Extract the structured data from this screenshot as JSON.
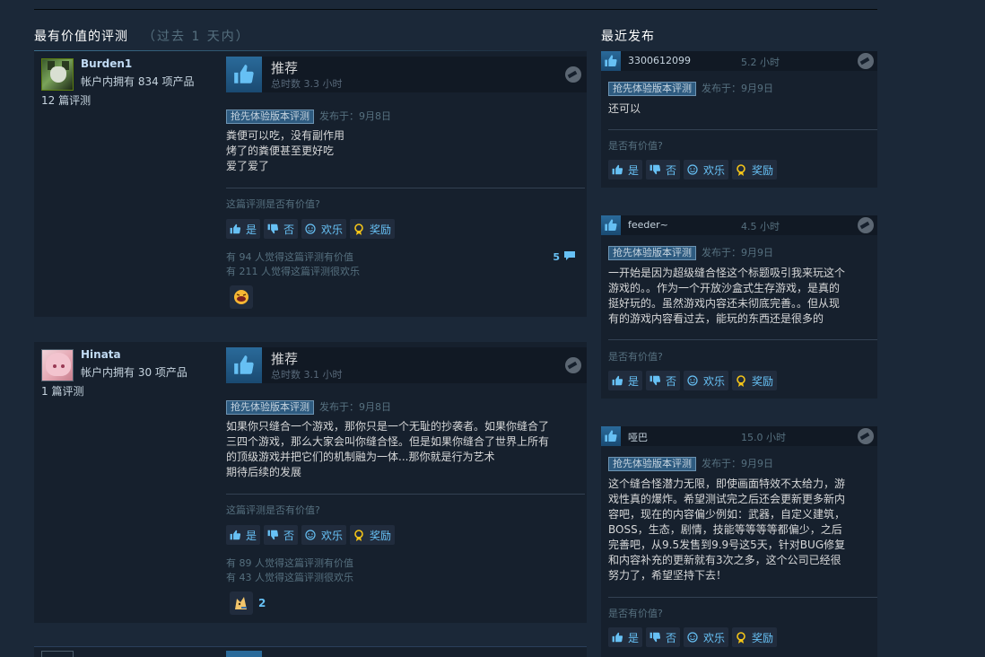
{
  "most_helpful": {
    "title": "最有价值的评测",
    "subtitle": "（过去 1 天内）"
  },
  "recent": {
    "title": "最近发布"
  },
  "buttons": {
    "yes": "是",
    "no": "否",
    "funny": "欢乐",
    "award": "奖励"
  },
  "helpful_question_long": "这篇评测是否有价值?",
  "helpful_question_short": "是否有价值?",
  "ea_tag": "抢先体验版本评测",
  "reviews": [
    {
      "author": "Burden1",
      "products_owned": "帐户内拥有 834 项产品",
      "review_count": "12 篇评测",
      "verdict": "推荐",
      "hours": "总时数 3.3 小时",
      "posted": "发布于：9月8日",
      "text": [
        "粪便可以吃，没有副作用",
        "烤了的粪便甚至更好吃",
        "爱了爱了"
      ],
      "helpful": "有 94 人觉得这篇评测有价值",
      "funny": "有 211 人觉得这篇评测很欢乐",
      "comments": "5",
      "award_count": ""
    },
    {
      "author": "Hinata",
      "products_owned": "帐户内拥有 30 项产品",
      "review_count": "1 篇评测",
      "verdict": "推荐",
      "hours": "总时数 3.1 小时",
      "posted": "发布于：9月8日",
      "text": [
        "如果你只缝合一个游戏，那你只是一个无耻的抄袭者。如果你缝合了",
        "三四个游戏，那么大家会叫你缝合怪。但是如果你缝合了世界上所有",
        "的顶级游戏并把它们的机制融为一体...那你就是行为艺术",
        "期待后续的发展"
      ],
      "helpful": "有 89 人觉得这篇评测有价值",
      "funny": "有 43 人觉得这篇评测很欢乐",
      "comments": "",
      "award_count": "2"
    }
  ],
  "recent_reviews": [
    {
      "author": "3300612099",
      "hours": "5.2 小时",
      "posted": "发布于：9月9日",
      "text": [
        "还可以"
      ]
    },
    {
      "author": "feeder~",
      "hours": "4.5 小时",
      "posted": "发布于：9月9日",
      "text": [
        "一开始是因为超级缝合怪这个标题吸引我来玩这个",
        "游戏的。。作为一个开放沙盒式生存游戏，是真的",
        "挺好玩的。虽然游戏内容还未彻底完善。。但从现",
        "有的游戏内容看过去，能玩的东西还是很多的"
      ]
    },
    {
      "author": "哑巴",
      "hours": "15.0 小时",
      "posted": "发布于：9月9日",
      "text": [
        "这个缝合怪潜力无限，即使画面特效不太给力，游",
        "戏性真的爆炸。希望测试完之后还会更新更多新内",
        "容吧，现在的内容偏少例如：武器，自定义建筑，",
        "BOSS，生态，剧情，技能等等等等都偏少，之后",
        "完善吧，从9.5发售到9.9号这5天，针对BUG修复",
        "和内容补充的更新就有3次之多，这个公司已经很",
        "努力了，希望坚持下去！"
      ]
    }
  ],
  "colors": {
    "background": "#1b2838",
    "panel": "#16202d",
    "link": "#67c1f5",
    "thumb": "#2a6a9a"
  }
}
